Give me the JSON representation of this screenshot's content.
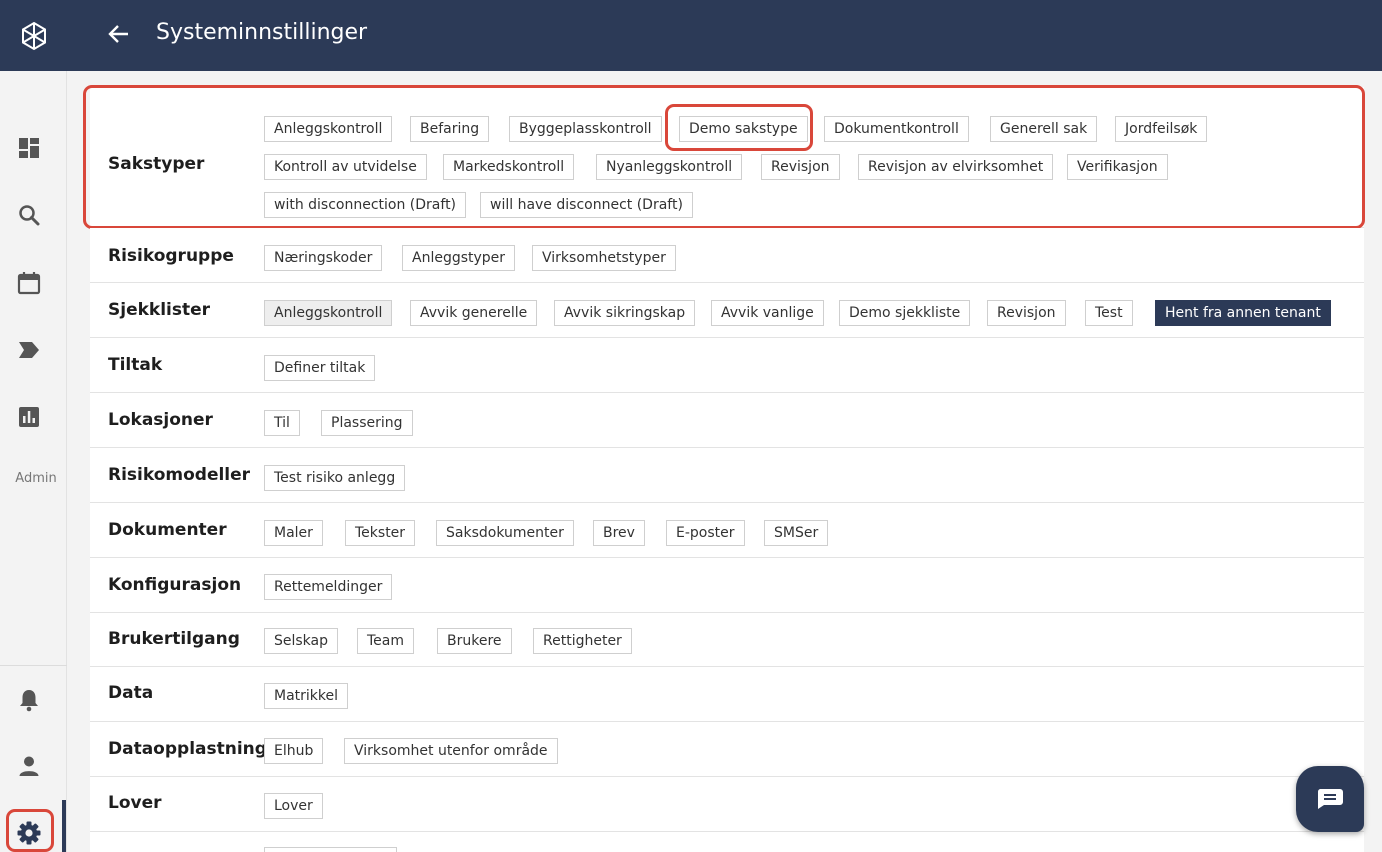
{
  "header": {
    "title": "Systeminnstillinger"
  },
  "sidebar": {
    "admin_label": "Admin"
  },
  "sections": {
    "sakstyper": {
      "title": "Sakstyper",
      "chips": [
        "Anleggskontroll",
        "Befaring",
        "Byggeplasskontroll",
        "Demo sakstype",
        "Dokumentkontroll",
        "Generell sak",
        "Jordfeilsøk",
        "Kontroll av utvidelse",
        "Markedskontroll",
        "Nyanleggskontroll",
        "Revisjon",
        "Revisjon av elvirksomhet",
        "Verifikasjon",
        "with disconnection (Draft)",
        "will have disconnect (Draft)"
      ]
    },
    "risikogruppe": {
      "title": "Risikogruppe",
      "chips": [
        "Næringskoder",
        "Anleggstyper",
        "Virksomhetstyper"
      ]
    },
    "sjekklister": {
      "title": "Sjekklister",
      "chips": [
        "Anleggskontroll",
        "Avvik generelle",
        "Avvik sikringskap",
        "Avvik vanlige",
        "Demo sjekkliste",
        "Revisjon",
        "Test"
      ],
      "action": "Hent fra annen tenant"
    },
    "tiltak": {
      "title": "Tiltak",
      "chips": [
        "Definer tiltak"
      ]
    },
    "lokasjoner": {
      "title": "Lokasjoner",
      "chips": [
        "Til",
        "Plassering"
      ]
    },
    "risikomodeller": {
      "title": "Risikomodeller",
      "chips": [
        "Test risiko anlegg"
      ]
    },
    "dokumenter": {
      "title": "Dokumenter",
      "chips": [
        "Maler",
        "Tekster",
        "Saksdokumenter",
        "Brev",
        "E-poster",
        "SMSer"
      ]
    },
    "konfigurasjon": {
      "title": "Konfigurasjon",
      "chips": [
        "Rettemeldinger"
      ]
    },
    "brukertilgang": {
      "title": "Brukertilgang",
      "chips": [
        "Selskap",
        "Team",
        "Brukere",
        "Rettigheter"
      ]
    },
    "data": {
      "title": "Data",
      "chips": [
        "Matrikkel"
      ]
    },
    "dataopplastning": {
      "title": "Dataopplastning",
      "chips": [
        "Elhub",
        "Virksomhet utenfor område"
      ]
    },
    "lover": {
      "title": "Lover",
      "chips": [
        "Lover"
      ]
    }
  },
  "colors": {
    "primary": "#2c3a57",
    "highlight": "#d9473a"
  },
  "icons": [
    "logo-icon",
    "dashboard-icon",
    "search-icon",
    "calendar-icon",
    "label-icon",
    "report-icon",
    "bell-icon",
    "person-icon",
    "gear-icon",
    "back-arrow-icon",
    "chat-icon"
  ]
}
